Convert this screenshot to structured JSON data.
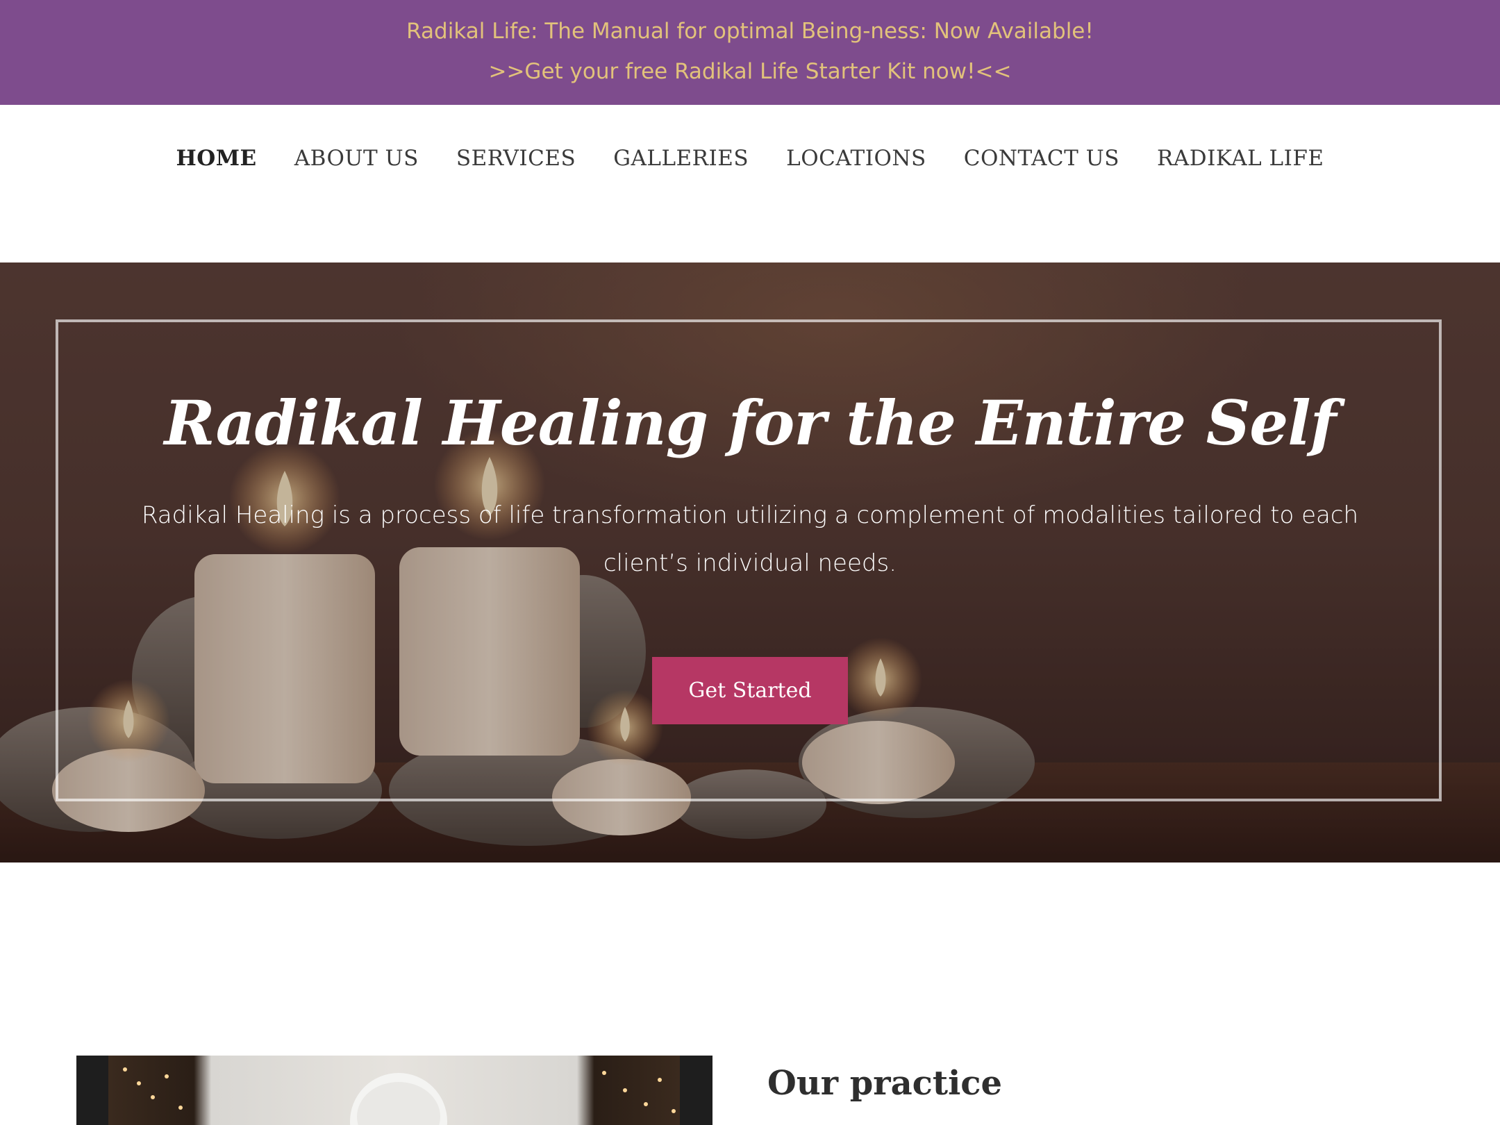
{
  "announcement": {
    "line1": "Radikal Life: The Manual for optimal Being-ness: Now Available!",
    "line2": ">>Get your free Radikal Life Starter Kit now!<<"
  },
  "nav": {
    "items": [
      {
        "label": "HOME",
        "active": true
      },
      {
        "label": "ABOUT US",
        "active": false
      },
      {
        "label": "SERVICES",
        "active": false
      },
      {
        "label": "GALLERIES",
        "active": false
      },
      {
        "label": "LOCATIONS",
        "active": false
      },
      {
        "label": "CONTACT US",
        "active": false
      },
      {
        "label": "RADIKAL LIFE",
        "active": false
      }
    ]
  },
  "hero": {
    "title": "Radikal Healing for the Entire Self",
    "description": "Radikal Healing is a process of life transformation utilizing a complement of modalities tailored to each client’s individual needs.",
    "cta_label": "Get Started"
  },
  "practice": {
    "title": "Our practice"
  },
  "colors": {
    "announcement_bg": "#7e4c8d",
    "announcement_text": "#e2c27b",
    "cta_bg": "#b63764",
    "nav_text": "#3a3a3a"
  }
}
